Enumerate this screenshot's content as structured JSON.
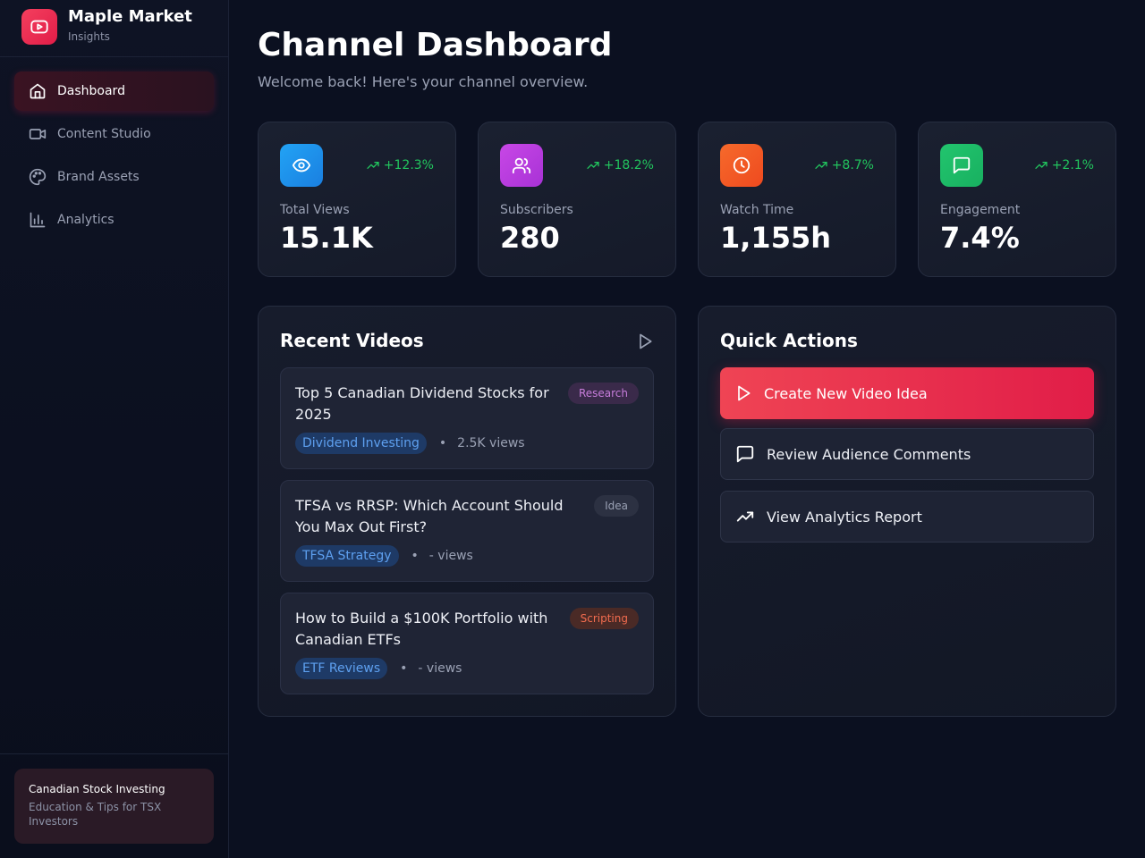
{
  "brand": {
    "name": "Maple Market",
    "subtitle": "Insights",
    "accent": "#e11d48"
  },
  "sidebar": {
    "items": [
      {
        "label": "Dashboard",
        "icon": "home-icon",
        "active": true
      },
      {
        "label": "Content Studio",
        "icon": "video-camera-icon",
        "active": false
      },
      {
        "label": "Brand Assets",
        "icon": "palette-icon",
        "active": false
      },
      {
        "label": "Analytics",
        "icon": "bar-chart-icon",
        "active": false
      }
    ],
    "footer": {
      "title": "Canadian Stock Investing",
      "description": "Education & Tips for TSX Investors"
    }
  },
  "header": {
    "title": "Channel Dashboard",
    "subtitle": "Welcome back! Here's your channel overview."
  },
  "stats": [
    {
      "label": "Total Views",
      "value": "15.1K",
      "trend": "+12.3%",
      "icon": "eye-icon",
      "color": "#1d9bf0"
    },
    {
      "label": "Subscribers",
      "value": "280",
      "trend": "+18.2%",
      "icon": "users-icon",
      "color": "#c63fe0"
    },
    {
      "label": "Watch Time",
      "value": "1,155h",
      "trend": "+8.7%",
      "icon": "clock-icon",
      "color": "#f05a28"
    },
    {
      "label": "Engagement",
      "value": "7.4%",
      "trend": "+2.1%",
      "icon": "message-icon",
      "color": "#1fbf6a"
    }
  ],
  "recent_videos": {
    "title": "Recent Videos",
    "items": [
      {
        "title": "Top 5 Canadian Dividend Stocks for 2025",
        "status": "Research",
        "tag": "Dividend Investing",
        "views": "2.5K views"
      },
      {
        "title": "TFSA vs RRSP: Which Account Should You Max Out First?",
        "status": "Idea",
        "tag": "TFSA Strategy",
        "views": "- views"
      },
      {
        "title": "How to Build a $100K Portfolio with Canadian ETFs",
        "status": "Scripting",
        "tag": "ETF Reviews",
        "views": "- views"
      }
    ],
    "separator": "•"
  },
  "quick_actions": {
    "title": "Quick Actions",
    "items": [
      {
        "label": "Create New Video Idea",
        "icon": "play-icon"
      },
      {
        "label": "Review Audience Comments",
        "icon": "message-icon"
      },
      {
        "label": "View Analytics Report",
        "icon": "trending-up-icon"
      }
    ]
  },
  "colors": {
    "trend_positive": "#22c55e",
    "status_research": "#c77ddb",
    "status_idea": "#9aa1b4",
    "status_scripting": "#f26c4f"
  }
}
